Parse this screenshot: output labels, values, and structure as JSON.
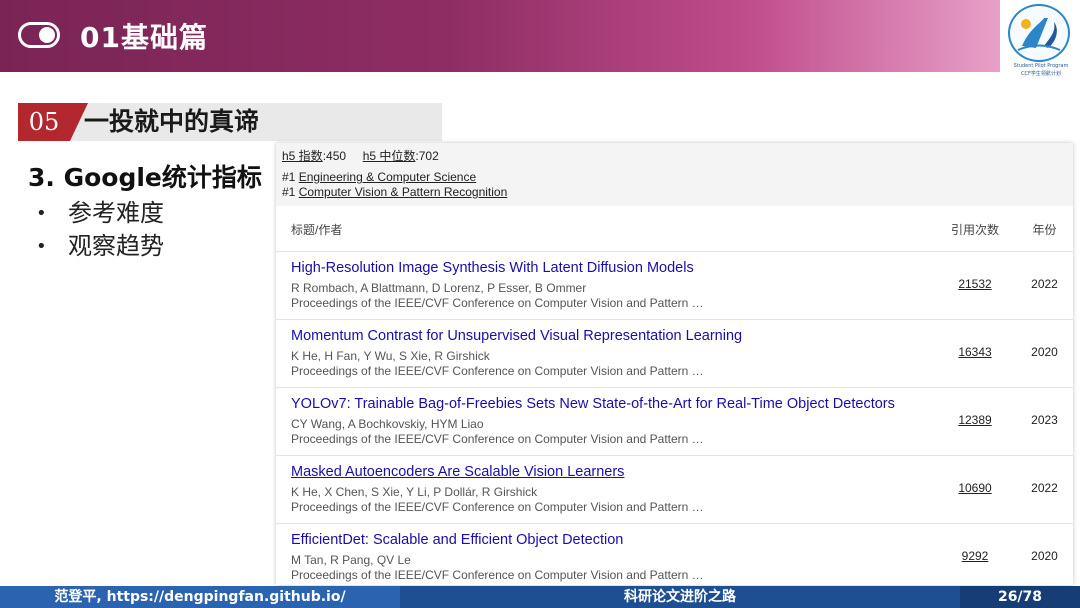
{
  "header": {
    "title": "01基础篇",
    "logo_text_1": "Student Pilot Program",
    "logo_text_2": "CCF学生领航计划"
  },
  "section": {
    "number": "05",
    "title": "一投就中的真谛"
  },
  "left": {
    "heading": "3. Google统计指标",
    "bullets": [
      "参考难度",
      "观察趋势"
    ]
  },
  "scholar": {
    "h5_index_label": "h5 指数",
    "h5_index_value": ":450",
    "h5_median_label": "h5 中位数",
    "h5_median_value": ":702",
    "categories": [
      {
        "rank": "#1",
        "name": "Engineering & Computer Science"
      },
      {
        "rank": "#1",
        "name": "Computer Vision & Pattern Recognition"
      }
    ],
    "columns": {
      "title_author": "标题/作者",
      "citations": "引用次数",
      "year": "年份"
    },
    "rows": [
      {
        "title": "High-Resolution Image Synthesis With Latent Diffusion Models",
        "authors": "R Rombach, A Blattmann, D Lorenz, P Esser, B Ommer",
        "venue": "Proceedings of the IEEE/CVF Conference on Computer Vision and Pattern …",
        "citations": "21532",
        "year": "2022"
      },
      {
        "title": "Momentum Contrast for Unsupervised Visual Representation Learning",
        "authors": "K He, H Fan, Y Wu, S Xie, R Girshick",
        "venue": "Proceedings of the IEEE/CVF Conference on Computer Vision and Pattern …",
        "citations": "16343",
        "year": "2020"
      },
      {
        "title": "YOLOv7: Trainable Bag-of-Freebies Sets New State-of-the-Art for Real-Time Object Detectors",
        "authors": "CY Wang, A Bochkovskiy, HYM Liao",
        "venue": "Proceedings of the IEEE/CVF Conference on Computer Vision and Pattern …",
        "citations": "12389",
        "year": "2023"
      },
      {
        "title": "Masked Autoencoders Are Scalable Vision Learners",
        "authors": "K He, X Chen, S Xie, Y Li, P Dollár, R Girshick",
        "venue": "Proceedings of the IEEE/CVF Conference on Computer Vision and Pattern …",
        "citations": "10690",
        "year": "2022"
      },
      {
        "title": "EfficientDet: Scalable and Efficient Object Detection",
        "authors": "M Tan, R Pang, QV Le",
        "venue": "Proceedings of the IEEE/CVF Conference on Computer Vision and Pattern …",
        "citations": "9292",
        "year": "2020"
      }
    ]
  },
  "footer": {
    "author": "范登平, https://dengpingfan.github.io/",
    "course": "科研论文进阶之路",
    "page": "26/78"
  },
  "colors": {
    "header_accent": "#8e2d64",
    "section_red": "#b3272f",
    "link_blue": "#1a0dab",
    "footer_blue": "#2b63b0"
  }
}
